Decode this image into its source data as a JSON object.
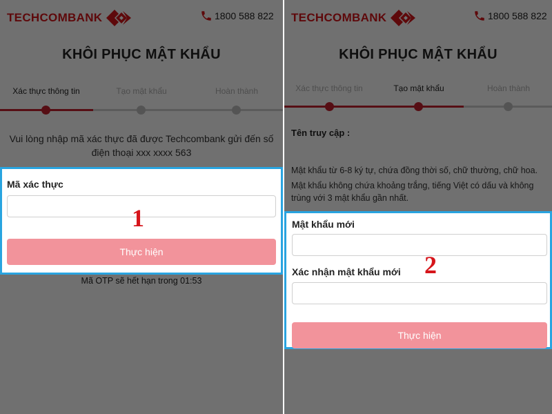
{
  "header": {
    "brand": "TECHCOMBANK",
    "hotline": "1800 588 822",
    "icons": [
      "techcombank-logo-icon",
      "phone-icon"
    ]
  },
  "title": "KHÔI PHỤC MẬT KHẨU",
  "steps": [
    "Xác thực thông tin",
    "Tạo mật khẩu",
    "Hoàn thành"
  ],
  "left": {
    "instruction_line1": "Vui lòng nhập mã xác thực đã được Techcombank gửi đến số",
    "instruction_line2": "điện thoại xxx xxxx 563",
    "otp_label": "Mã xác thực",
    "otp_value": "",
    "submit_label": "Thực hiện",
    "marker": "1",
    "otp_note": "Mã OTP sẽ hết hạn trong 01:53"
  },
  "right": {
    "username_label": "Tên truy cập :",
    "rule1": "Mật khẩu từ 6-8 ký tự, chứa đồng thời số, chữ thường, chữ hoa.",
    "rule2_line1": "Mật khẩu không chứa khoảng trắng, tiếng Việt có dấu và không",
    "rule2_line2": "trùng với 3 mật khẩu gần nhất.",
    "new_password_label": "Mật khẩu mới",
    "confirm_password_label": "Xác nhận mật khẩu mới",
    "submit_label": "Thực hiện",
    "marker": "2"
  },
  "colors": {
    "brand_red": "#d6151b",
    "highlight_blue": "#29a4e0",
    "button_pink": "#f2939b"
  }
}
